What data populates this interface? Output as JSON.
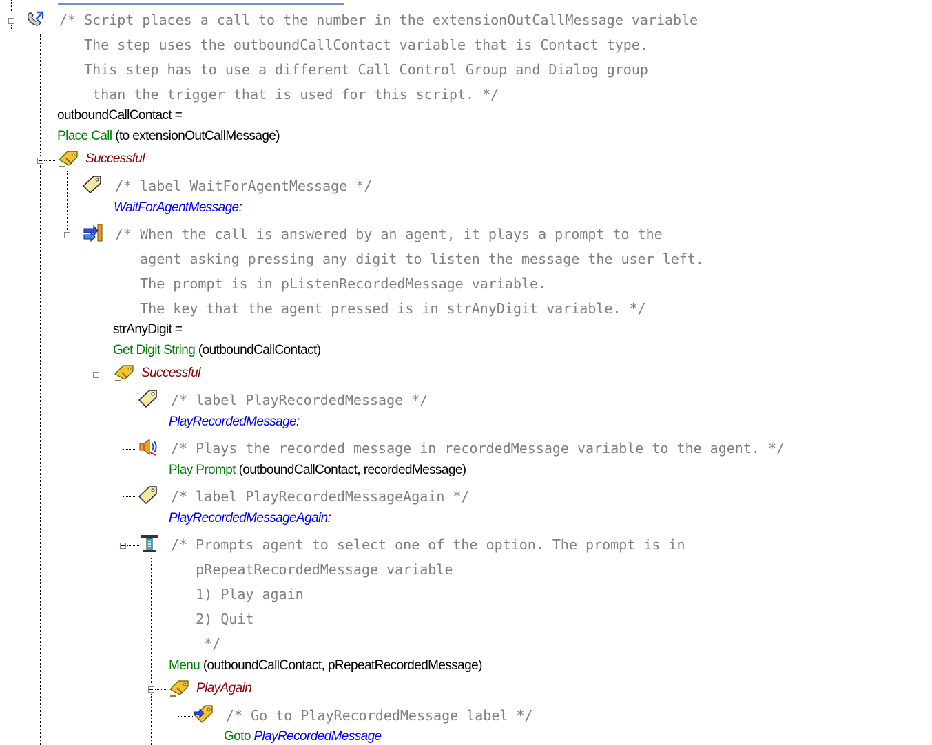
{
  "place_call": {
    "comment": "/* Script places a call to the number in the extensionOutCallMessage variable\n   The step uses the outboundCallContact variable that is Contact type.\n   This step has to use a different Call Control Group and Dialog group\n    than the trigger that is used for this script. */",
    "assign": "outboundCallContact =",
    "step": "Place Call",
    "args": " (to extensionOutCallMessage)",
    "branch": "Successful"
  },
  "label_wait": {
    "comment": "/* label WaitForAgentMessage */",
    "label": "WaitForAgentMessage:"
  },
  "get_digit": {
    "comment": "/* When the call is answered by an agent, it plays a prompt to the\n   agent asking pressing any digit to listen the message the user left.\n   The prompt is in pListenRecordedMessage variable.\n   The key that the agent pressed is in strAnyDigit variable. */",
    "assign": "strAnyDigit =",
    "step": "Get Digit String",
    "args": " (outboundCallContact)",
    "branch": "Successful"
  },
  "label_play": {
    "comment": "/* label PlayRecordedMessage */",
    "label": "PlayRecordedMessage:"
  },
  "play_prompt": {
    "comment": "/* Plays the recorded message in recordedMessage variable to the agent. */",
    "step": "Play Prompt",
    "args": " (outboundCallContact, recordedMessage)"
  },
  "label_play_again": {
    "comment": "/* label PlayRecordedMessageAgain */",
    "label": "PlayRecordedMessageAgain:"
  },
  "menu": {
    "comment": "/* Prompts agent to select one of the option. The prompt is in\n   pRepeatRecordedMessage variable\n   1) Play again\n   2) Quit\n    */",
    "step": "Menu",
    "args": " (outboundCallContact, pRepeatRecordedMessage)",
    "branch": "PlayAgain"
  },
  "goto": {
    "comment": "/* Go to PlayRecordedMessage label */",
    "step": "Goto",
    "target": "PlayRecordedMessage"
  }
}
